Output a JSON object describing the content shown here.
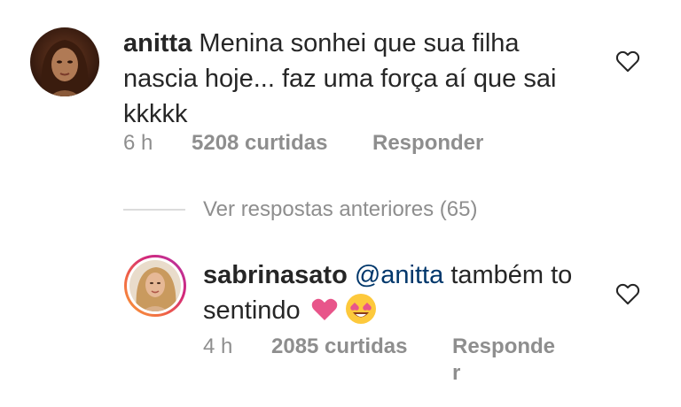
{
  "comment": {
    "username": "anitta",
    "text": "Menina sonhei que sua filha nascia hoje... faz uma força aí que sai kkkkk",
    "time": "6 h",
    "likes": "5208 curtidas",
    "reply_label": "Responder"
  },
  "view_replies_label": "Ver respostas anteriores (65)",
  "reply": {
    "username": "sabrinasato",
    "mention": "@anitta",
    "text": "também to sentindo",
    "time": "4 h",
    "likes": "2085 curtidas",
    "reply_label_line1": "Responde",
    "reply_label_line2": "r"
  },
  "icons": {
    "like_comment": "heart-outline-icon",
    "like_reply": "heart-outline-icon",
    "emoji_heart": "pink-heart-emoji",
    "emoji_face": "heart-eyes-emoji"
  },
  "colors": {
    "text": "#262626",
    "secondary": "#8e8e8e",
    "mention": "#00376b",
    "story_ring": "#d3287a"
  }
}
